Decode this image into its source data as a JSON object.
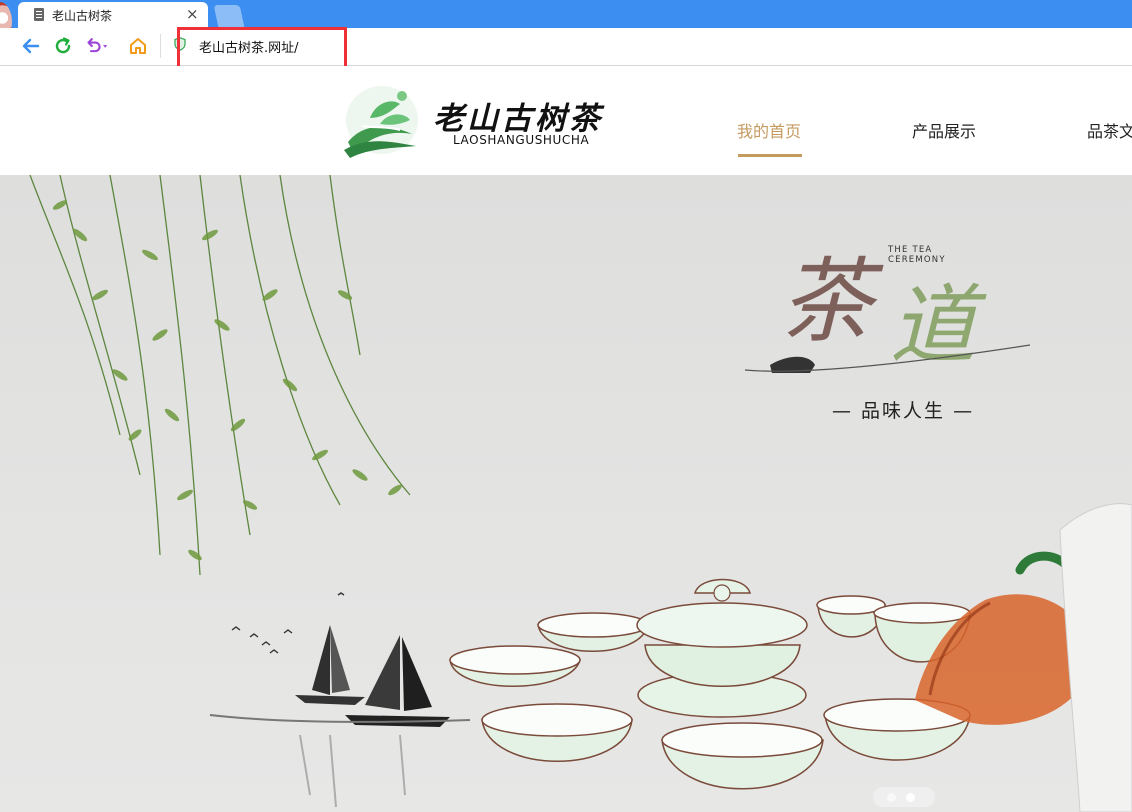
{
  "browser": {
    "tab": {
      "title": "老山古树茶",
      "close_glyph": "×"
    },
    "address_bar": {
      "url": "老山古树茶.网址/"
    },
    "icons": [
      "back-arrow-icon",
      "refresh-icon",
      "undo-icon",
      "home-icon",
      "security-shield-icon",
      "page-icon",
      "close-icon"
    ]
  },
  "site": {
    "logo": {
      "name_cn": "老山古树茶",
      "name_en": "LAOSHANGUSHUCHA"
    },
    "nav": [
      {
        "label": "我的首页",
        "active": true
      },
      {
        "label": "产品展示",
        "active": false
      },
      {
        "label": "品茶文",
        "active": false
      }
    ]
  },
  "hero": {
    "calligraphy_en": [
      "THE TEA",
      "CEREMONY"
    ],
    "calligraphy_cn": "茶道",
    "tagline": "— 品味人生 —",
    "carousel": {
      "slide_count": 2,
      "active_index": 2
    }
  },
  "colors": {
    "browser_blue": "#3c8ff0",
    "accent_gold": "#c59a5f",
    "highlight_red": "#ef3038",
    "logo_green": "#3f9a4e"
  }
}
